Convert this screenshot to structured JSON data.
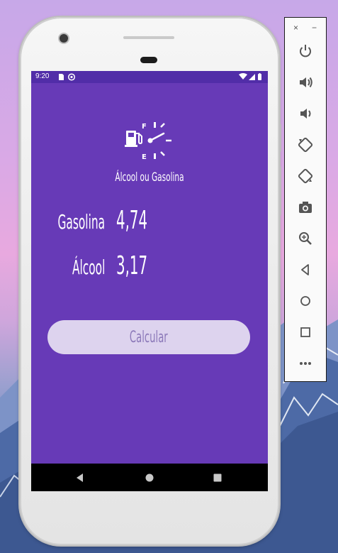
{
  "status_bar": {
    "time": "9:20"
  },
  "app": {
    "title": "Álcool ou Gasolina",
    "gasolina_label": "Gasolina",
    "gasolina_value": "4,74",
    "alcool_label": "Álcool",
    "alcool_value": "3,17",
    "calc_button": "Calcular",
    "logo_f": "F",
    "logo_e": "E"
  },
  "colors": {
    "primary": "#673ab7",
    "primary_dark": "#512da8",
    "button_bg": "#ddd3ee",
    "button_text": "#8c79b9"
  },
  "toolbar": {
    "close": "×",
    "minimize": "−",
    "more": "•••",
    "items": [
      "power-icon",
      "volume-up-icon",
      "volume-down-icon",
      "rotate-left-icon",
      "rotate-right-icon",
      "camera-icon",
      "zoom-icon",
      "back-icon",
      "home-icon",
      "overview-icon",
      "more-icon"
    ]
  },
  "nav_bar": {
    "items": [
      "back-icon",
      "home-icon",
      "recents-icon"
    ]
  }
}
